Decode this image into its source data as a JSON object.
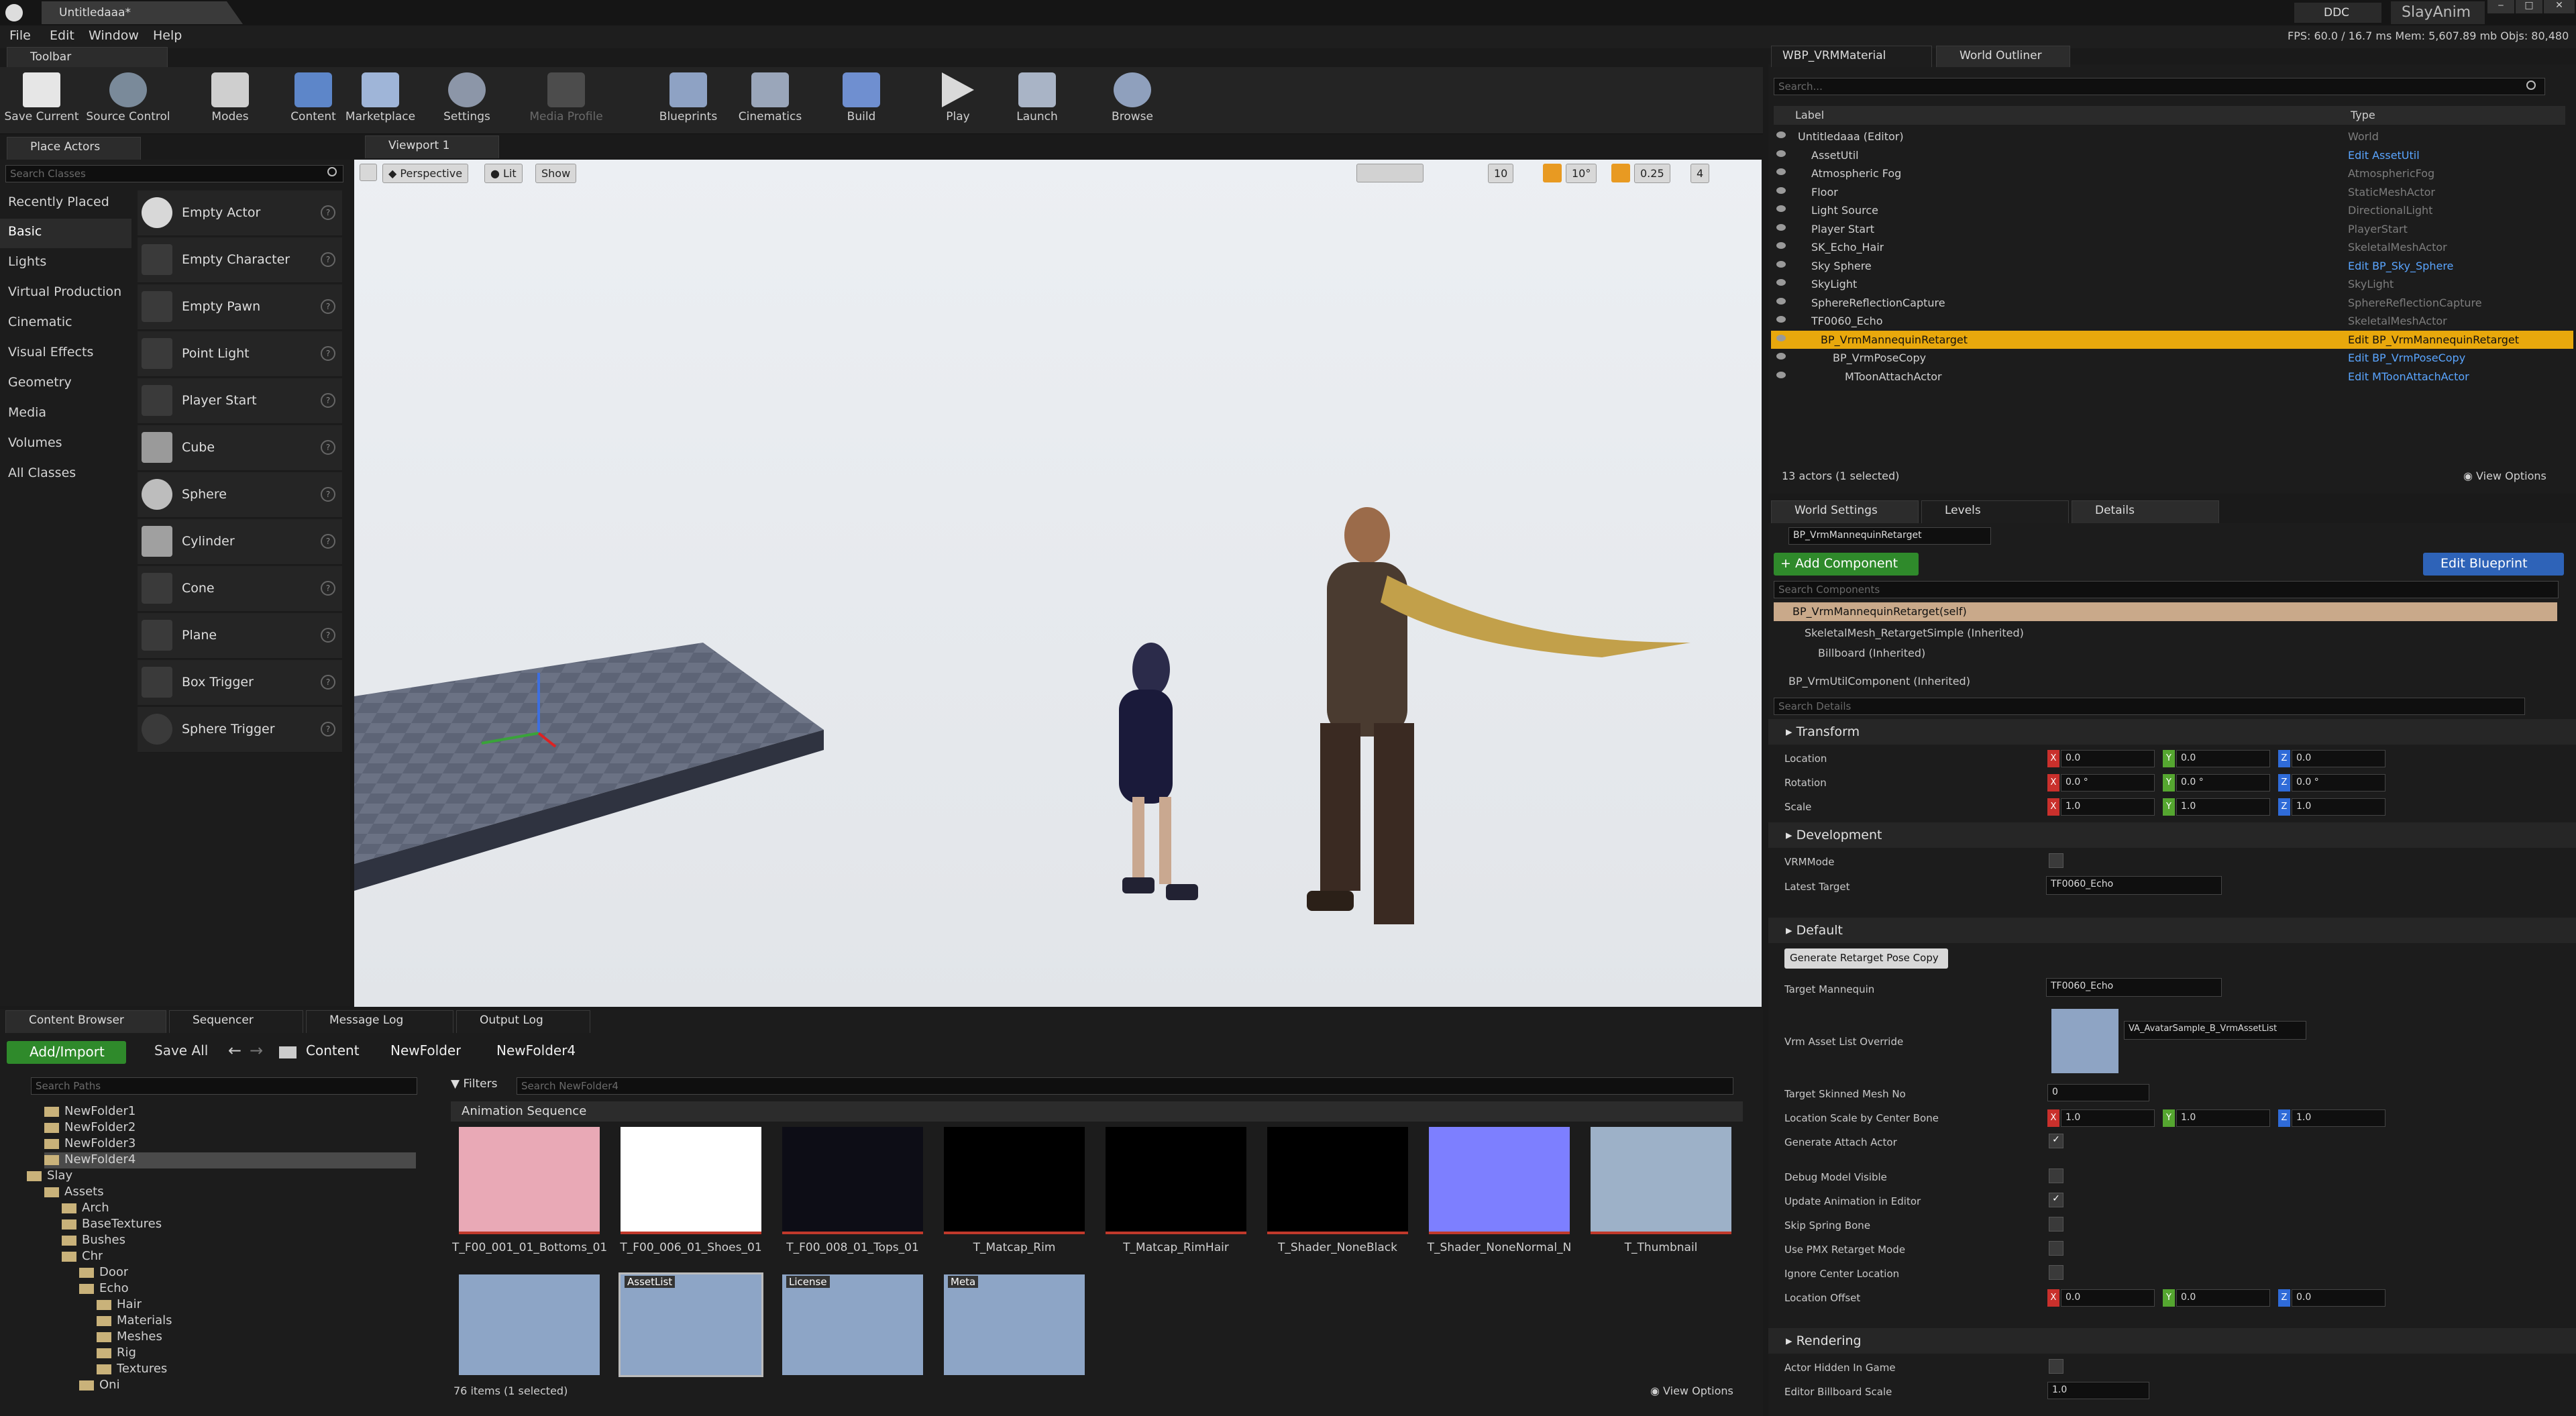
{
  "titlebar": {
    "doc_tab": "Untitledaaa*",
    "ddc": "DDC",
    "project": "SlayAnim",
    "fps": "FPS: 60.0",
    "frame": "/ 16.7 ms",
    "mem": "Mem: 5,607.89 mb",
    "objs": "Objs: 80,480"
  },
  "menu": [
    "File",
    "Edit",
    "Window",
    "Help"
  ],
  "toolbar": {
    "tab": "Toolbar",
    "buttons": [
      "Save Current",
      "Source Control",
      "Modes",
      "Content",
      "Marketplace",
      "Settings",
      "Media Profile",
      "Blueprints",
      "Cinematics",
      "Build",
      "Play",
      "Launch",
      "Browse"
    ]
  },
  "place_actors": {
    "tab": "Place Actors",
    "search_placeholder": "Search Classes",
    "categories": [
      "Recently Placed",
      "Basic",
      "Lights",
      "Virtual Production",
      "Cinematic",
      "Visual Effects",
      "Geometry",
      "Media",
      "Volumes",
      "All Classes"
    ],
    "selected_category": "Basic",
    "actors": [
      "Empty Actor",
      "Empty Character",
      "Empty Pawn",
      "Point Light",
      "Player Start",
      "Cube",
      "Sphere",
      "Cylinder",
      "Cone",
      "Plane",
      "Box Trigger",
      "Sphere Trigger"
    ]
  },
  "viewport": {
    "tab": "Viewport 1",
    "perspective": "Perspective",
    "lit": "Lit",
    "show": "Show",
    "grid_snap": "10",
    "rot_snap": "10°",
    "scale_snap": "0.25",
    "cam_speed": "4"
  },
  "outliner": {
    "tabs": [
      "WBP_VRMMaterial",
      "World Outliner"
    ],
    "search_placeholder": "Search...",
    "col_label": "Label",
    "col_type": "Type",
    "rows": [
      {
        "label": "Untitledaaa (Editor)",
        "type": "World",
        "link": false
      },
      {
        "label": "AssetUtil",
        "type": "Edit AssetUtil",
        "link": true
      },
      {
        "label": "Atmospheric Fog",
        "type": "AtmosphericFog",
        "link": false
      },
      {
        "label": "Floor",
        "type": "StaticMeshActor",
        "link": false
      },
      {
        "label": "Light Source",
        "type": "DirectionalLight",
        "link": false
      },
      {
        "label": "Player Start",
        "type": "PlayerStart",
        "link": false
      },
      {
        "label": "SK_Echo_Hair",
        "type": "SkeletalMeshActor",
        "link": false
      },
      {
        "label": "Sky Sphere",
        "type": "Edit BP_Sky_Sphere",
        "link": true
      },
      {
        "label": "SkyLight",
        "type": "SkyLight",
        "link": false
      },
      {
        "label": "SphereReflectionCapture",
        "type": "SphereReflectionCapture",
        "link": false
      },
      {
        "label": "TF0060_Echo",
        "type": "SkeletalMeshActor",
        "link": false
      },
      {
        "label": "BP_VrmMannequinRetarget",
        "type": "Edit BP_VrmMannequinRetarget",
        "link": true
      },
      {
        "label": "BP_VrmPoseCopy",
        "type": "Edit BP_VrmPoseCopy",
        "link": true
      },
      {
        "label": "MToonAttachActor",
        "type": "Edit MToonAttachActor",
        "link": true
      }
    ],
    "status": "13 actors (1 selected)",
    "view_options": "View Options"
  },
  "details": {
    "tabs": [
      "World Settings",
      "Levels",
      "Details"
    ],
    "actor_name": "BP_VrmMannequinRetarget",
    "add_component": "+ Add Component",
    "edit_blueprint": "Edit Blueprint",
    "search_components": "Search Components",
    "components": [
      "BP_VrmMannequinRetarget(self)",
      "SkeletalMesh_RetargetSimple (Inherited)",
      "Billboard (Inherited)",
      "BP_VrmUtilComponent (Inherited)"
    ],
    "search_details": "Search Details",
    "transform": {
      "header": "Transform",
      "location_label": "Location",
      "rotation_label": "Rotation",
      "scale_label": "Scale",
      "location": [
        "0.0",
        "0.0",
        "0.0"
      ],
      "rotation": [
        "0.0 °",
        "0.0 °",
        "0.0 °"
      ],
      "scale": [
        "1.0",
        "1.0",
        "1.0"
      ]
    },
    "development": {
      "header": "Development",
      "vrm_mode": "VRMMode",
      "latest_target": "Latest Target",
      "latest_target_value": "TF0060_Echo"
    },
    "default": {
      "header": "Default",
      "gen_button": "Generate Retarget Pose Copy",
      "target_mannequin": "Target Mannequin",
      "target_mannequin_value": "TF0060_Echo",
      "vrm_asset_list": "Vrm Asset List Override",
      "vrm_asset_list_value": "VA_AvatarSample_B_VrmAssetList",
      "target_mesh_no": "Target Skinned Mesh No",
      "target_mesh_no_value": "0",
      "loc_scale": "Location Scale by Center Bone",
      "loc_scale_values": [
        "1.0",
        "1.0",
        "1.0"
      ],
      "gen_attach": "Generate Attach Actor",
      "debug_visible": "Debug Model Visible",
      "update_anim": "Update Animation in Editor",
      "skip_spring": "Skip Spring Bone",
      "use_pmx": "Use PMX Retarget Mode",
      "ignore_center": "Ignore Center Location",
      "loc_offset": "Location Offset",
      "loc_offset_values": [
        "0.0",
        "0.0",
        "0.0"
      ]
    },
    "rendering": {
      "header": "Rendering",
      "hidden_in_game": "Actor Hidden In Game",
      "billboard_scale": "Editor Billboard Scale",
      "billboard_scale_value": "1.0"
    }
  },
  "content_browser": {
    "tabs": [
      "Content Browser",
      "Sequencer",
      "Message Log",
      "Output Log"
    ],
    "add_import": "Add/Import",
    "save_all": "Save All",
    "path": [
      "Content",
      "NewFolder",
      "NewFolder4"
    ],
    "search_paths": "Search Paths",
    "filters": "Filters",
    "search_folder": "Search NewFolder4",
    "tree": [
      {
        "label": "NewFolder1",
        "depth": 1
      },
      {
        "label": "NewFolder2",
        "depth": 1
      },
      {
        "label": "NewFolder3",
        "depth": 1
      },
      {
        "label": "NewFolder4",
        "depth": 1,
        "selected": true
      },
      {
        "label": "Slay",
        "depth": 0
      },
      {
        "label": "Assets",
        "depth": 1
      },
      {
        "label": "Arch",
        "depth": 2
      },
      {
        "label": "BaseTextures",
        "depth": 2
      },
      {
        "label": "Bushes",
        "depth": 2
      },
      {
        "label": "Chr",
        "depth": 2
      },
      {
        "label": "Door",
        "depth": 3
      },
      {
        "label": "Echo",
        "depth": 3
      },
      {
        "label": "Hair",
        "depth": 4
      },
      {
        "label": "Materials",
        "depth": 4
      },
      {
        "label": "Meshes",
        "depth": 4
      },
      {
        "label": "Rig",
        "depth": 4
      },
      {
        "label": "Textures",
        "depth": 4
      },
      {
        "label": "Oni",
        "depth": 3
      }
    ],
    "group_header": "Animation Sequence",
    "assets": [
      {
        "label": "T_F00_001_01_Bottoms_01",
        "color": "#e9a9b6"
      },
      {
        "label": "T_F00_006_01_Shoes_01",
        "color": "#ffffff"
      },
      {
        "label": "T_F00_008_01_Tops_01",
        "color": "#0d0d16"
      },
      {
        "label": "T_Matcap_Rim",
        "color": "#000000"
      },
      {
        "label": "T_Matcap_RimHair",
        "color": "#000000"
      },
      {
        "label": "T_Shader_NoneBlack",
        "color": "#000000"
      },
      {
        "label": "T_Shader_NoneNormal_N",
        "color": "#7d7fff"
      },
      {
        "label": "T_Thumbnail",
        "color": "#9db1c8"
      }
    ],
    "row2_tags": [
      "",
      "AssetList",
      "License",
      "Meta"
    ],
    "status": "76 items (1 selected)",
    "view_options": "View Options"
  }
}
